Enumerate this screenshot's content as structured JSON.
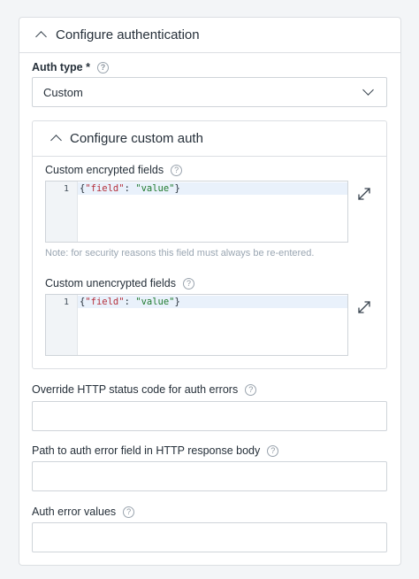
{
  "section": {
    "title": "Configure authentication"
  },
  "auth_type": {
    "label": "Auth type *",
    "value": "Custom"
  },
  "custom_auth": {
    "title": "Configure custom auth",
    "encrypted": {
      "label": "Custom encrypted fields",
      "line_number": "1",
      "code": {
        "open": "{",
        "key": "\"field\"",
        "sep": ": ",
        "value": "\"value\"",
        "close": "}"
      },
      "note": "Note: for security reasons this field must always be re-entered."
    },
    "unencrypted": {
      "label": "Custom unencrypted fields",
      "line_number": "1",
      "code": {
        "open": "{",
        "key": "\"field\"",
        "sep": ": ",
        "value": "\"value\"",
        "close": "}"
      }
    }
  },
  "override_status": {
    "label": "Override HTTP status code for auth errors",
    "value": ""
  },
  "error_path": {
    "label": "Path to auth error field in HTTP response body",
    "value": ""
  },
  "error_values": {
    "label": "Auth error values",
    "value": ""
  },
  "help_glyph": "?",
  "icons": {
    "collapse": "chevron-up-icon",
    "dropdown": "chevron-down-icon",
    "help": "help-icon",
    "expand": "expand-icon"
  },
  "colors": {
    "json_key": "#b5303b",
    "json_value": "#1f7a2e",
    "note_text": "#9aa6b2",
    "active_line": "#e9f1fb"
  }
}
